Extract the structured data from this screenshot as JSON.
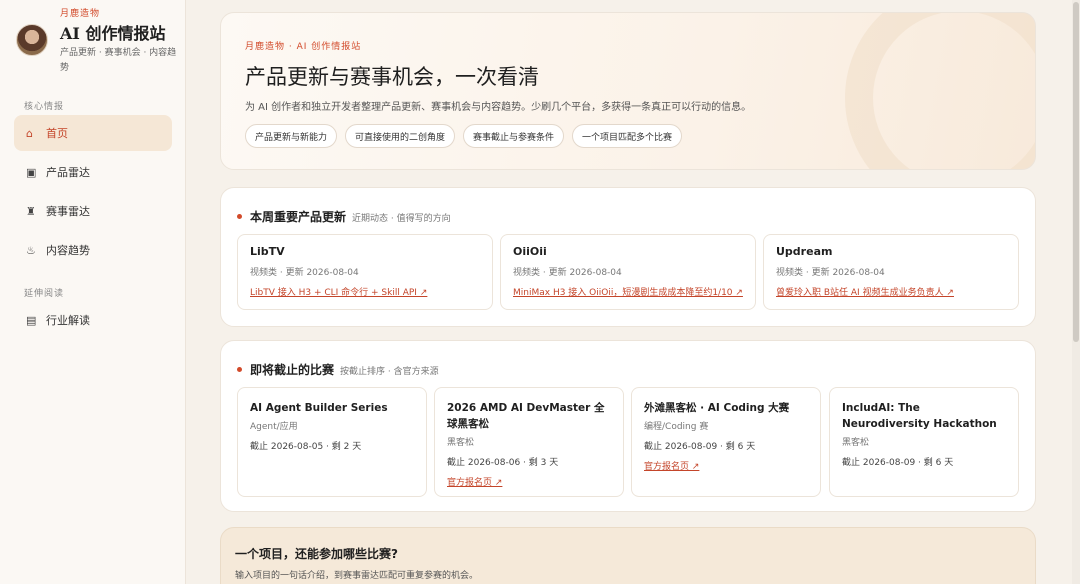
{
  "sidebar": {
    "brand_kicker": "月鹿造物",
    "brand_title": "AI 创作情报站",
    "brand_sub": "产品更新 · 赛事机会 · 内容趋势",
    "section_core": "核心情报",
    "section_ext": "延伸阅读",
    "items": [
      {
        "icon": "⌂",
        "icon_name": "home-icon",
        "label": "首页"
      },
      {
        "icon": "▣",
        "icon_name": "product-icon",
        "label": "产品雷达"
      },
      {
        "icon": "♜",
        "icon_name": "trophy-icon",
        "label": "赛事雷达"
      },
      {
        "icon": "♨",
        "icon_name": "trend-icon",
        "label": "内容趋势"
      },
      {
        "icon": "▤",
        "icon_name": "book-icon",
        "label": "行业解读"
      }
    ]
  },
  "hero": {
    "kicker": "月鹿造物 · AI 创作情报站",
    "title": "产品更新与赛事机会，一次看清",
    "desc": "为 AI 创作者和独立开发者整理产品更新、赛事机会与内容趋势。少刷几个平台，多获得一条真正可以行动的信息。",
    "tags": [
      "产品更新与新能力",
      "可直接使用的二创角度",
      "赛事截止与参赛条件",
      "一个项目匹配多个比赛"
    ]
  },
  "updates": {
    "title": "本周重要产品更新",
    "subtitle": "近期动态 · 值得写的方向",
    "cards": [
      {
        "name": "LibTV",
        "meta": "视频类 · 更新 2026-08-04",
        "link": "LibTV 接入 H3 + CLI 命令行 + Skill API ↗"
      },
      {
        "name": "OiiOii",
        "meta": "视频类 · 更新 2026-08-04",
        "link": "MiniMax H3 接入 OiiOii，短漫剧生成成本降至约1/10 ↗"
      },
      {
        "name": "Updream",
        "meta": "视频类 · 更新 2026-08-04",
        "link": "曾爱玲入职 B站任 AI 视频生成业务负责人 ↗"
      }
    ]
  },
  "competitions": {
    "title": "即将截止的比赛",
    "subtitle": "按截止排序 · 含官方来源",
    "cards": [
      {
        "name": "AI Agent Builder Series",
        "category": "Agent/应用",
        "deadline": "截止 2026-08-05 · 剩 2 天",
        "link": ""
      },
      {
        "name": "2026 AMD AI DevMaster 全球黑客松",
        "category": "黑客松",
        "deadline": "截止 2026-08-06 · 剩 3 天",
        "link": "官方报名页 ↗"
      },
      {
        "name": "外滩黑客松 · AI Coding 大赛",
        "category": "编程/Coding 赛",
        "deadline": "截止 2026-08-09 · 剩 6 天",
        "link": "官方报名页 ↗"
      },
      {
        "name": "IncludAI: The Neurodiversity Hackathon",
        "category": "黑客松",
        "deadline": "截止 2026-08-09 · 剩 6 天",
        "link": ""
      }
    ]
  },
  "match": {
    "title": "一个项目，还能参加哪些比赛?",
    "desc": "输入项目的一句话介绍，到赛事雷达匹配可重复参赛的机会。"
  },
  "colors": {
    "accent": "#d24a2a",
    "active_bg": "#f5e7d6"
  }
}
